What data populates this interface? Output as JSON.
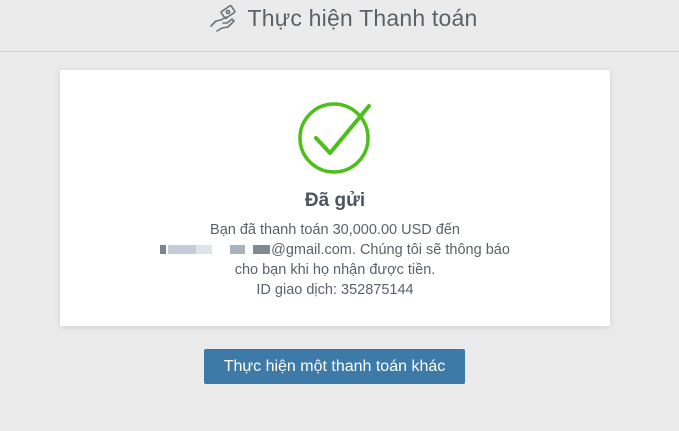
{
  "header": {
    "title": "Thực hiện Thanh toán",
    "icon": "payment-hand-icon"
  },
  "confirmation": {
    "icon": "success-check-icon",
    "icon_color": "#4cbf1a",
    "status": "Đã gửi",
    "line1": "Bạn đã thanh toán 30,000.00 USD đến",
    "email_suffix": "@gmail.com. Chúng tôi sẽ thông báo",
    "line3": "cho bạn khi họ nhận được tiền.",
    "transaction_label": "ID giao dịch: 352875144"
  },
  "actions": {
    "another_payment_label": "Thực hiện một thanh toán khác",
    "button_color": "#3e7aa7"
  }
}
